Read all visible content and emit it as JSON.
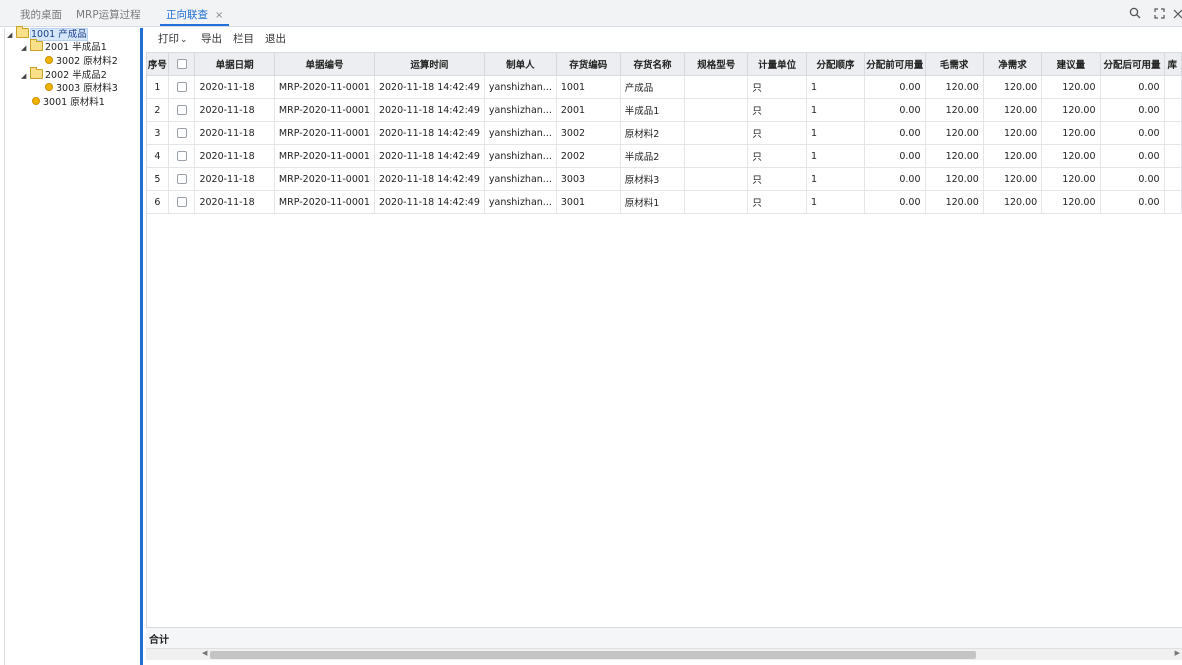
{
  "tabs": [
    {
      "label": "我的桌面"
    },
    {
      "label": "MRP运算过程"
    },
    {
      "label": "正向联查",
      "close": "×"
    }
  ],
  "tree": {
    "nodes": [
      {
        "label": "1001 产成品"
      },
      {
        "label": "2001 半成品1"
      },
      {
        "label": "3002 原材料2"
      },
      {
        "label": "2002 半成品2"
      },
      {
        "label": "3003 原材料3"
      },
      {
        "label": "3001 原材料1"
      }
    ]
  },
  "toolbar": {
    "print": "打印",
    "print_caret": "⌄",
    "export": "导出",
    "columns": "栏目",
    "exit": "退出"
  },
  "grid": {
    "headers": [
      "序号",
      "",
      "单据日期",
      "单据编号",
      "运算时间",
      "制单人",
      "存货编码",
      "存货名称",
      "规格型号",
      "计量单位",
      "分配顺序",
      "分配前可用量",
      "毛需求",
      "净需求",
      "建议量",
      "分配后可用量",
      "库"
    ],
    "rows": [
      [
        "1",
        "",
        "2020-11-18",
        "MRP-2020-11-0001",
        "2020-11-18 14:42:49",
        "yanshizhan...",
        "1001",
        "产成品",
        "",
        "只",
        "1",
        "0.00",
        "120.00",
        "120.00",
        "120.00",
        "0.00",
        ""
      ],
      [
        "2",
        "",
        "2020-11-18",
        "MRP-2020-11-0001",
        "2020-11-18 14:42:49",
        "yanshizhan...",
        "2001",
        "半成品1",
        "",
        "只",
        "1",
        "0.00",
        "120.00",
        "120.00",
        "120.00",
        "0.00",
        ""
      ],
      [
        "3",
        "",
        "2020-11-18",
        "MRP-2020-11-0001",
        "2020-11-18 14:42:49",
        "yanshizhan...",
        "3002",
        "原材料2",
        "",
        "只",
        "1",
        "0.00",
        "120.00",
        "120.00",
        "120.00",
        "0.00",
        ""
      ],
      [
        "4",
        "",
        "2020-11-18",
        "MRP-2020-11-0001",
        "2020-11-18 14:42:49",
        "yanshizhan...",
        "2002",
        "半成品2",
        "",
        "只",
        "1",
        "0.00",
        "120.00",
        "120.00",
        "120.00",
        "0.00",
        ""
      ],
      [
        "5",
        "",
        "2020-11-18",
        "MRP-2020-11-0001",
        "2020-11-18 14:42:49",
        "yanshizhan...",
        "3003",
        "原材料3",
        "",
        "只",
        "1",
        "0.00",
        "120.00",
        "120.00",
        "120.00",
        "0.00",
        ""
      ],
      [
        "6",
        "",
        "2020-11-18",
        "MRP-2020-11-0001",
        "2020-11-18 14:42:49",
        "yanshizhan...",
        "3001",
        "原材料1",
        "",
        "只",
        "1",
        "0.00",
        "120.00",
        "120.00",
        "120.00",
        "0.00",
        ""
      ]
    ]
  },
  "footer": {
    "total_label": "合计"
  },
  "icons": {
    "search": "search-icon",
    "fullscreen": "fullscreen-icon",
    "close": "close-icon",
    "accent_color": "#1f6fd6"
  }
}
